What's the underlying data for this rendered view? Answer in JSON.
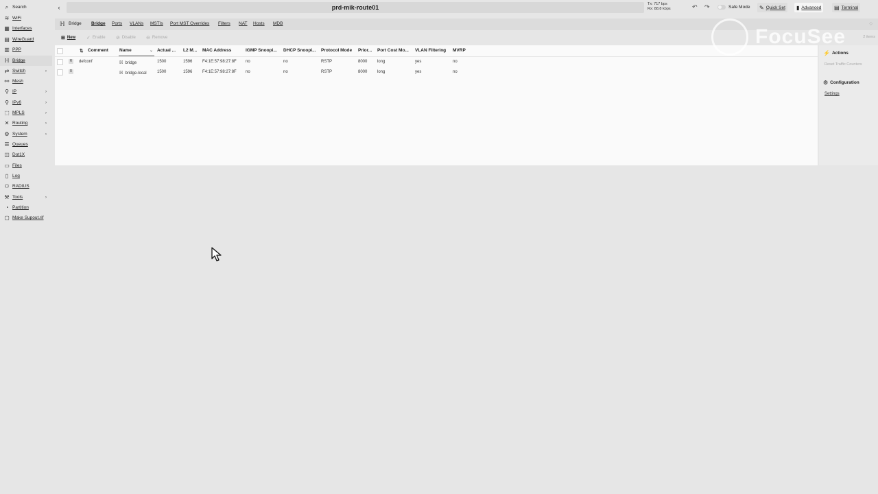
{
  "window": {
    "title": "prd-mik-route01"
  },
  "traffic": {
    "tx": "Tx: 717 bps",
    "rx": "Rx: 88.8 kbps"
  },
  "topbar": {
    "safe_mode": "Safe Mode",
    "quick_set": "Quick Set",
    "advanced": "Advanced",
    "terminal": "Terminal"
  },
  "sidebar": {
    "items": [
      {
        "label": "Search",
        "icon": "search-icon"
      },
      {
        "label": "WiFi",
        "icon": "wifi-icon"
      },
      {
        "label": "Interfaces",
        "icon": "interfaces-icon"
      },
      {
        "label": "WireGuard",
        "icon": "wireguard-icon"
      },
      {
        "label": "PPP",
        "icon": "ppp-icon"
      },
      {
        "label": "Bridge",
        "icon": "bridge-icon"
      },
      {
        "label": "Switch",
        "icon": "switch-icon"
      },
      {
        "label": "Mesh",
        "icon": "mesh-icon"
      },
      {
        "label": "IP",
        "icon": "ip-icon"
      },
      {
        "label": "IPv6",
        "icon": "ipv6-icon"
      },
      {
        "label": "MPLS",
        "icon": "mpls-icon"
      },
      {
        "label": "Routing",
        "icon": "routing-icon"
      },
      {
        "label": "System",
        "icon": "system-icon"
      },
      {
        "label": "Queues",
        "icon": "queues-icon"
      },
      {
        "label": "Dot1X",
        "icon": "dot1x-icon"
      },
      {
        "label": "Files",
        "icon": "files-icon"
      },
      {
        "label": "Log",
        "icon": "log-icon"
      },
      {
        "label": "RADIUS",
        "icon": "radius-icon"
      },
      {
        "label": "Tools",
        "icon": "tools-icon"
      },
      {
        "label": "Partition",
        "icon": "partition-icon"
      },
      {
        "label": "Make Supout.rif",
        "icon": "supout-icon"
      }
    ]
  },
  "menu": {
    "title": "Bridge",
    "tabs": [
      "Bridge",
      "Ports",
      "VLANs",
      "MSTIs",
      "Port MST Overrides",
      "Filters",
      "NAT",
      "Hosts",
      "MDB"
    ]
  },
  "toolbar": {
    "new": "New",
    "enable": "Enable",
    "disable": "Disable",
    "remove": "Remove",
    "count": "2 items"
  },
  "table": {
    "columns": [
      "Comment",
      "Name",
      "Actual ...",
      "L2 M...",
      "MAC Address",
      "IGMP Snoopi...",
      "DHCP Snoopi...",
      "Protocol Mode",
      "Prior...",
      "Port Cost Mo...",
      "VLAN Filtering",
      "MVRP"
    ],
    "rows": [
      {
        "flag": "R",
        "comment": "defconf",
        "name": "bridge",
        "actual_mtu": "1500",
        "l2mtu": "1596",
        "mac": "F4:1E:57:98:27:8F",
        "igmp": "no",
        "dhcp": "no",
        "protocol": "RSTP",
        "priority": "8000",
        "port_cost": "long",
        "vlan_filtering": "yes",
        "mvrp": "no"
      },
      {
        "flag": "R",
        "comment": "",
        "name": "bridge-local",
        "actual_mtu": "1500",
        "l2mtu": "1596",
        "mac": "F4:1E:57:98:27:8F",
        "igmp": "no",
        "dhcp": "no",
        "protocol": "RSTP",
        "priority": "8000",
        "port_cost": "long",
        "vlan_filtering": "yes",
        "mvrp": "no"
      }
    ]
  },
  "right_panel": {
    "actions_title": "Actions",
    "reset_counters": "Reset Traffic Counters",
    "configuration_title": "Configuration",
    "settings": "Settings"
  },
  "watermark": {
    "text": "FocuSee"
  }
}
